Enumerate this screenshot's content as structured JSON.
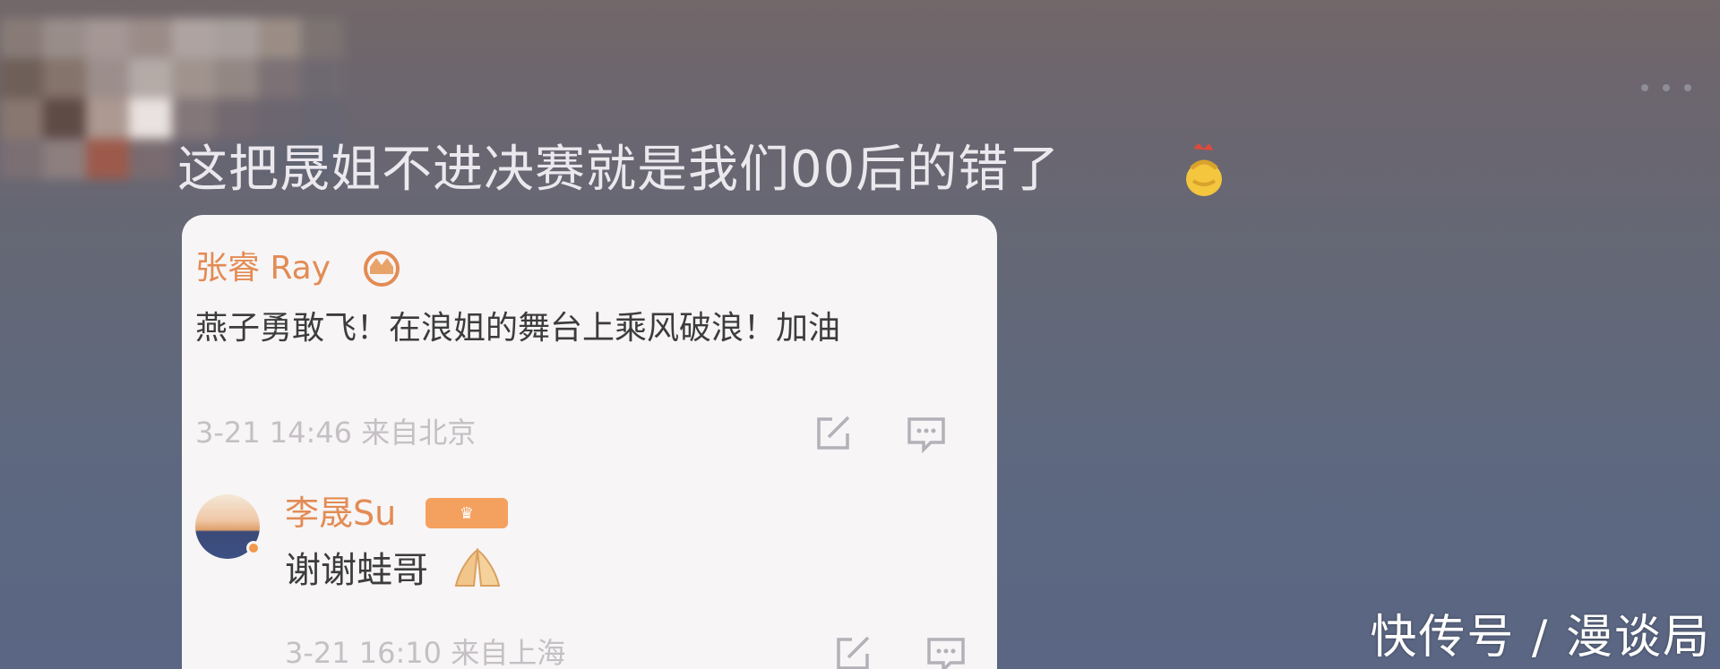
{
  "comment": {
    "text": "这把晟姐不进决赛就是我们00后的错了"
  },
  "quoted_post": {
    "author": "张睿 Ray",
    "text": "燕子勇敢飞！在浪姐的舞台上乘风破浪！加油",
    "meta": "3-21 14:46  来自北京"
  },
  "reply": {
    "author": "李晟Su",
    "text": "谢谢蛙哥",
    "meta": "3-21 16:10  来自上海"
  },
  "watermark": "快传号 / 漫谈局",
  "icons": [
    "more-icon",
    "clapping-emoji-icon",
    "crown-icon",
    "share-icon",
    "comment-icon",
    "vip-badge-icon",
    "praying-hands-icon"
  ],
  "colors": {
    "author_orange": "#e38b54",
    "meta_gray": "#c4c0c4",
    "card_bg": "#f7f5f6"
  }
}
